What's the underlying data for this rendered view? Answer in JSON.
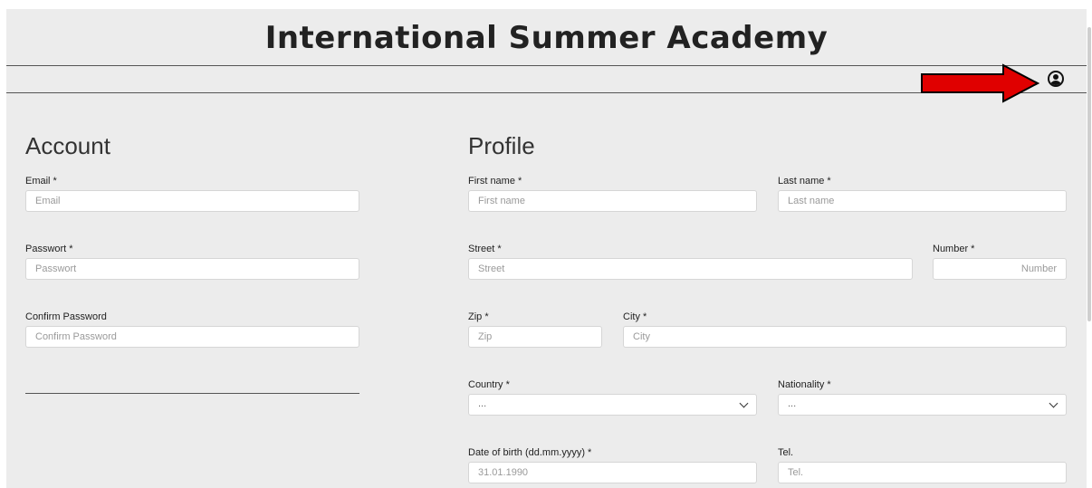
{
  "header": {
    "title": "International Summer Academy",
    "profile_icon": "user-circle-icon"
  },
  "annotation": {
    "arrow_color": "#e00000"
  },
  "account": {
    "heading": "Account",
    "email_label": "Email *",
    "email_placeholder": "Email",
    "password_label": "Passwort *",
    "password_placeholder": "Passwort",
    "confirm_label": "Confirm Password",
    "confirm_placeholder": "Confirm Password"
  },
  "profile": {
    "heading": "Profile",
    "first_name_label": "First name *",
    "first_name_placeholder": "First name",
    "last_name_label": "Last name *",
    "last_name_placeholder": "Last name",
    "street_label": "Street *",
    "street_placeholder": "Street",
    "number_label": "Number *",
    "number_placeholder": "Number",
    "zip_label": "Zip *",
    "zip_placeholder": "Zip",
    "city_label": "City *",
    "city_placeholder": "City",
    "country_label": "Country *",
    "country_value": "...",
    "nationality_label": "Nationality *",
    "nationality_value": "...",
    "dob_label": "Date of birth (dd.mm.yyyy) *",
    "dob_placeholder": "31.01.1990",
    "tel_label": "Tel.",
    "tel_placeholder": "Tel."
  }
}
